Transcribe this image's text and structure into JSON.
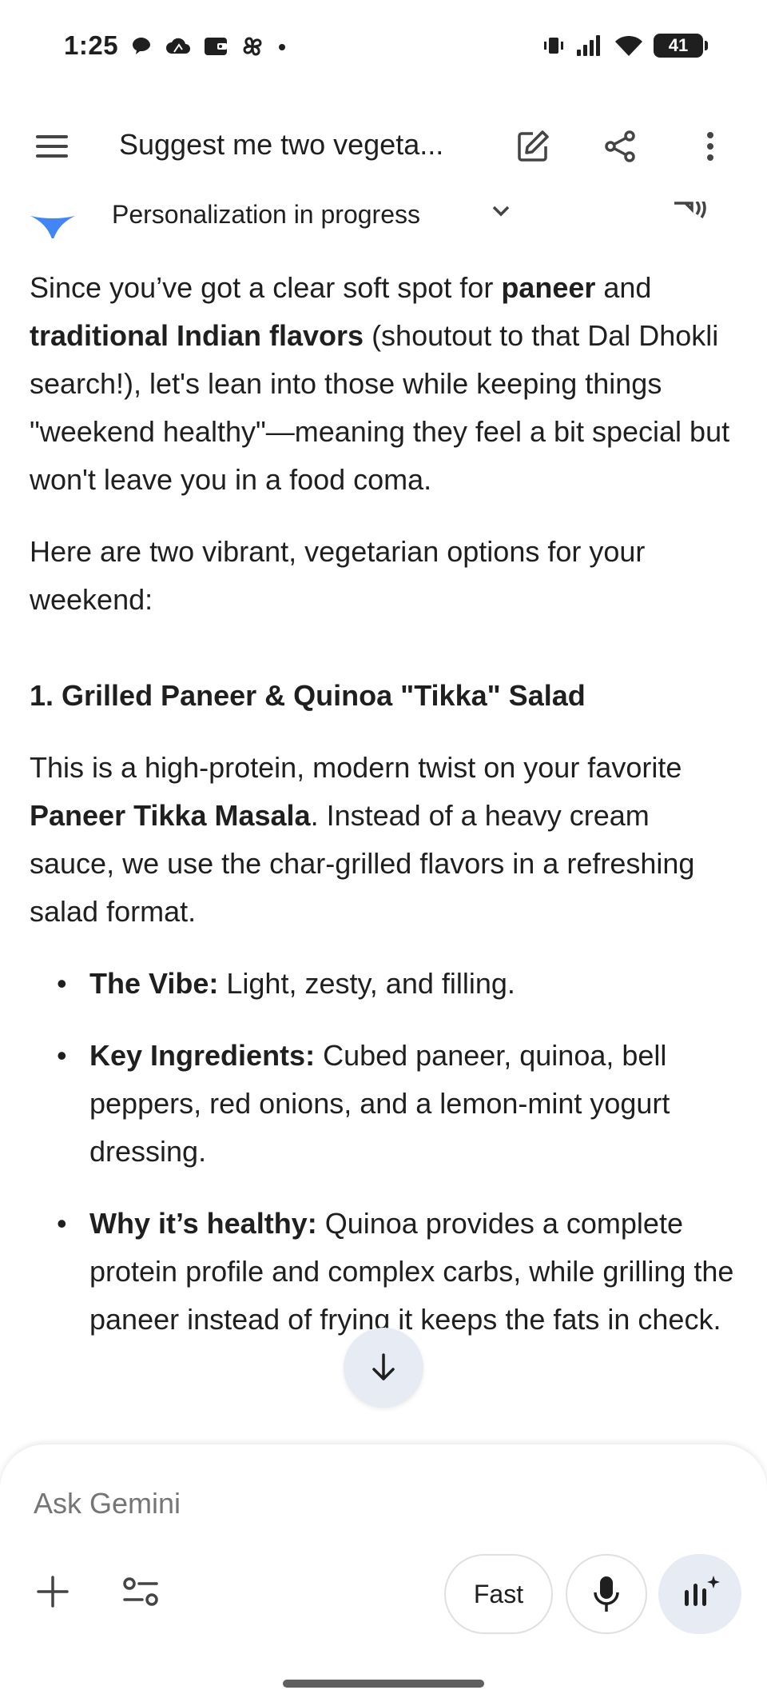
{
  "status_bar": {
    "time": "1:25",
    "battery_level": "41",
    "notification_icons": [
      "chat-bubble-icon",
      "cloud-icon",
      "wallet-icon",
      "pinwheel-icon",
      "more-notifications-dot-icon"
    ],
    "system_icons": [
      "vibrate-icon",
      "cellular-signal-icon",
      "wifi-icon",
      "battery-icon"
    ]
  },
  "header": {
    "title": "Suggest me two vegeta...",
    "icons": [
      "menu-icon",
      "edit-icon",
      "share-icon",
      "more-vert-icon"
    ]
  },
  "personalization": {
    "label": "Personalization in progress"
  },
  "content": {
    "para1": {
      "t1": "Since you’ve got a clear soft spot for ",
      "b1": "paneer",
      "t2": " and ",
      "b2": "traditional Indian flavors",
      "t3": " (shoutout to that Dal Dhokli search!), let's lean into those while keeping things \"weekend healthy\"—meaning they feel a bit special but won't leave you in a food coma."
    },
    "para2": "Here are two vibrant, vegetarian options for your weekend:",
    "heading1": "1. Grilled Paneer & Quinoa \"Tikka\" Salad",
    "para3": {
      "t1": "This is a high-protein, modern twist on your favorite ",
      "b1": "Paneer Tikka Masala",
      "t2": ". Instead of a heavy cream sauce, we use the char-grilled flavors in a refreshing salad format."
    },
    "bullets": [
      {
        "label": "The Vibe:",
        "text": " Light, zesty, and filling."
      },
      {
        "label": "Key Ingredients:",
        "text": " Cubed paneer, quinoa, bell peppers, red onions, and a lemon-mint yogurt dressing."
      },
      {
        "label": "Why it’s healthy:",
        "text": " Quinoa provides a complete protein profile and complex carbs, while grilling the paneer instead of frying it keeps the fats in check."
      }
    ]
  },
  "composer": {
    "placeholder": "Ask Gemini",
    "fast_label": "Fast"
  },
  "colors": {
    "accent_gemini_blue": "#4285f4",
    "live_button_bg": "#e6ebf4",
    "text_primary": "#1f1f1f",
    "placeholder": "#757575"
  }
}
